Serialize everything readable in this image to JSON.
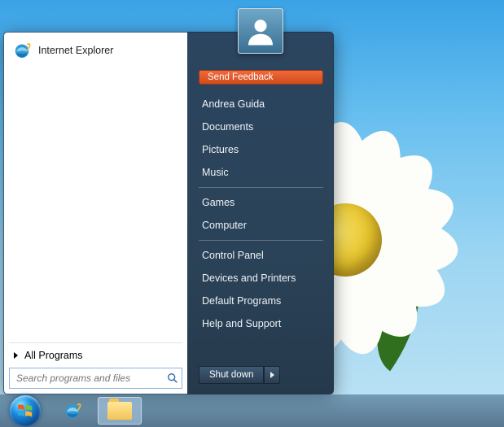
{
  "left": {
    "pinned": [
      {
        "label": "Internet Explorer",
        "icon": "ie-icon"
      }
    ],
    "all_programs": "All Programs",
    "search_placeholder": "Search programs and files"
  },
  "right": {
    "send_feedback": "Send Feedback",
    "groups": [
      [
        "Andrea Guida",
        "Documents",
        "Pictures",
        "Music"
      ],
      [
        "Games",
        "Computer"
      ],
      [
        "Control Panel",
        "Devices and Printers",
        "Default Programs",
        "Help and Support"
      ]
    ],
    "shutdown": "Shut down"
  },
  "taskbar": {
    "items": [
      "start-orb",
      "ie",
      "explorer"
    ]
  }
}
